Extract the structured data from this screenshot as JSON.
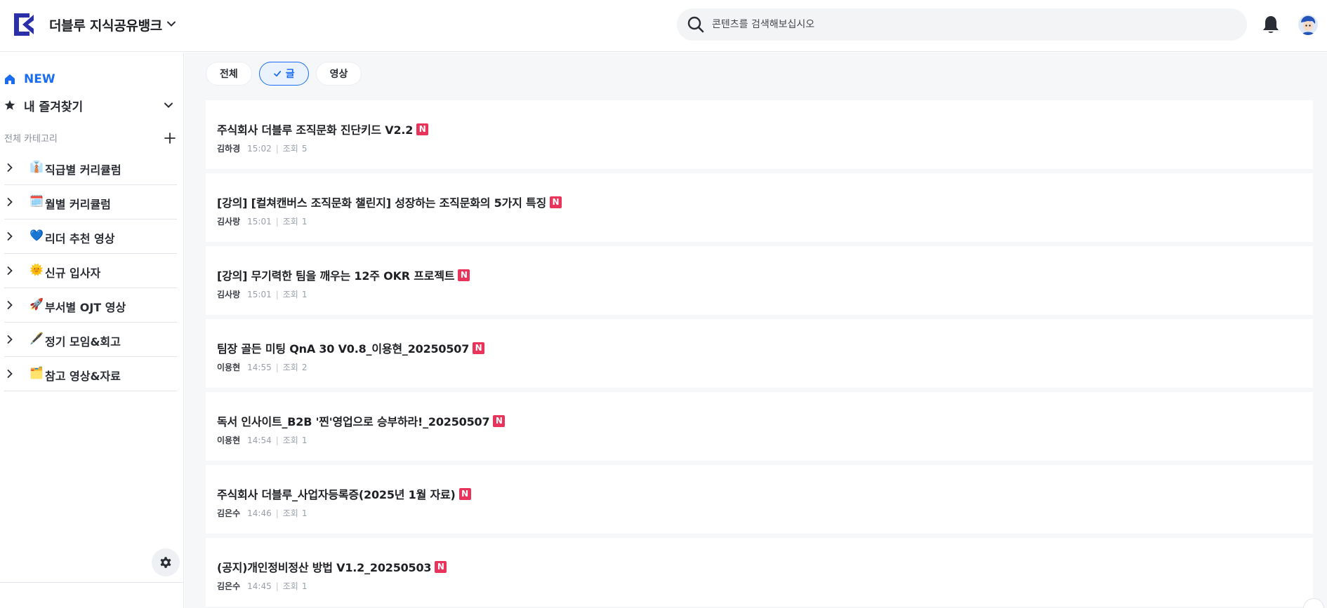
{
  "header": {
    "app_title": "더블루 지식공유뱅크",
    "search_placeholder": "콘텐츠를 검색해보십시오"
  },
  "sidebar": {
    "new_label": "NEW",
    "favorites_label": "내 즐겨찾기",
    "category_header": "전체 카테고리",
    "categories": [
      {
        "emoji": "👔",
        "label": "직급별 커리큘럼"
      },
      {
        "emoji": "🗓️",
        "label": "월별 커리큘럼"
      },
      {
        "emoji": "💙",
        "label": "리더 추천 영상"
      },
      {
        "emoji": "🌞",
        "label": "신규 입사자"
      },
      {
        "emoji": "🚀",
        "label": "부서별 OJT 영상"
      },
      {
        "emoji": "🖋️",
        "label": "정기 모임&회고"
      },
      {
        "emoji": "🗂️",
        "label": "참고 영상&자료"
      }
    ]
  },
  "filters": {
    "all": "전체",
    "article": "글",
    "video": "영상",
    "active": "article"
  },
  "posts": [
    {
      "title": "주식회사 더블루 조직문화 진단키드 V2.2",
      "badge": "N",
      "author": "김하경",
      "time": "15:02",
      "views_label": "조회",
      "views": "5"
    },
    {
      "title": "[강의] [컬쳐캔버스 조직문화 챌린지] 성장하는 조직문화의 5가지 특징",
      "badge": "N",
      "author": "김사랑",
      "time": "15:01",
      "views_label": "조회",
      "views": "1"
    },
    {
      "title": "[강의] 무기력한 팀을 깨우는 12주 OKR 프로젝트",
      "badge": "N",
      "author": "김사랑",
      "time": "15:01",
      "views_label": "조회",
      "views": "1"
    },
    {
      "title": "팀장 골든 미팅 QnA 30 V0.8_이용현_20250507",
      "badge": "N",
      "author": "이용현",
      "time": "14:55",
      "views_label": "조회",
      "views": "2"
    },
    {
      "title": "독서 인사이트_B2B '찐'영업으로 승부하라!_20250507",
      "badge": "N",
      "author": "이용현",
      "time": "14:54",
      "views_label": "조회",
      "views": "1"
    },
    {
      "title": "주식회사 더블루_사업자등록증(2025년 1월 자료)",
      "badge": "N",
      "author": "김은수",
      "time": "14:46",
      "views_label": "조회",
      "views": "1"
    },
    {
      "title": "(공지)개인정비정산 방법 V1.2_20250503",
      "badge": "N",
      "author": "김은수",
      "time": "14:45",
      "views_label": "조회",
      "views": "1"
    }
  ],
  "colors": {
    "accent": "#1a6cf2",
    "badge": "#e8335a",
    "logo": "#2b2fa8"
  }
}
